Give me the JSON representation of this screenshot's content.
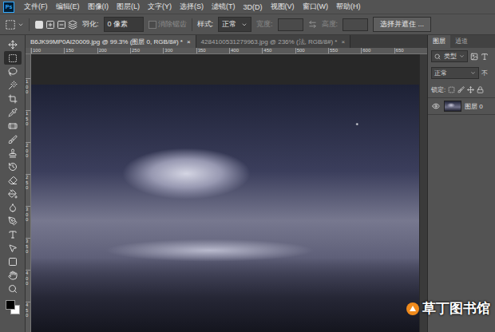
{
  "window": {
    "app_logo": "Ps"
  },
  "menu": [
    "文件(F)",
    "编辑(E)",
    "图像(I)",
    "图层(L)",
    "文字(Y)",
    "选择(S)",
    "滤镜(T)",
    "3D(D)",
    "视图(V)",
    "窗口(W)",
    "帮助(H)"
  ],
  "options": {
    "feather_label": "羽化:",
    "feather_value": "0 像素",
    "antialias": {
      "label": "消除锯齿",
      "checked": false,
      "disabled": true
    },
    "style_label": "样式:",
    "style_value": "正常",
    "width_label": "宽度:",
    "width_disabled": true,
    "height_label": "高度:",
    "height_disabled": true,
    "mask_button": "选择并遮住 ..."
  },
  "tabs": [
    {
      "label": "B6JK99MP0AI20009.jpg @ 99.3% (图层 0, RGB/8#) *",
      "close": "×",
      "selected": true
    },
    {
      "label": "4284100531279963.jpg @ 236% (法, RGB/8#) *",
      "close": "×",
      "selected": false
    }
  ],
  "rulers": {
    "top": [
      "100",
      "150",
      "200",
      "250",
      "300",
      "350",
      "400",
      "450",
      "500",
      "550",
      "600",
      "650"
    ],
    "left": [
      "100",
      "150",
      "200",
      "250",
      "300",
      "350",
      "400",
      "450"
    ]
  },
  "tools": [
    {
      "selected": false
    },
    {
      "selected": true
    },
    {
      "selected": false
    },
    {
      "selected": false
    },
    {
      "selected": false
    },
    {
      "selected": false
    },
    {
      "selected": false
    },
    {
      "selected": false
    },
    {
      "selected": false
    },
    {
      "selected": false
    },
    {
      "selected": false
    },
    {
      "selected": false
    },
    {
      "selected": false
    },
    {
      "selected": false
    },
    {
      "selected": false
    },
    {
      "selected": false
    },
    {
      "selected": false
    },
    {
      "selected": false
    },
    {
      "selected": false
    }
  ],
  "layers_panel": {
    "tabs": [
      {
        "label": "图层",
        "selected": true
      },
      {
        "label": "通道",
        "selected": false
      }
    ],
    "filter": "类型",
    "blend_mode": "正常",
    "opacity_label": "不",
    "lock_label": "锁定:",
    "layers": [
      {
        "name": "图层 0",
        "visible": true,
        "selected": false
      }
    ]
  },
  "watermark": "草丁图书馆"
}
